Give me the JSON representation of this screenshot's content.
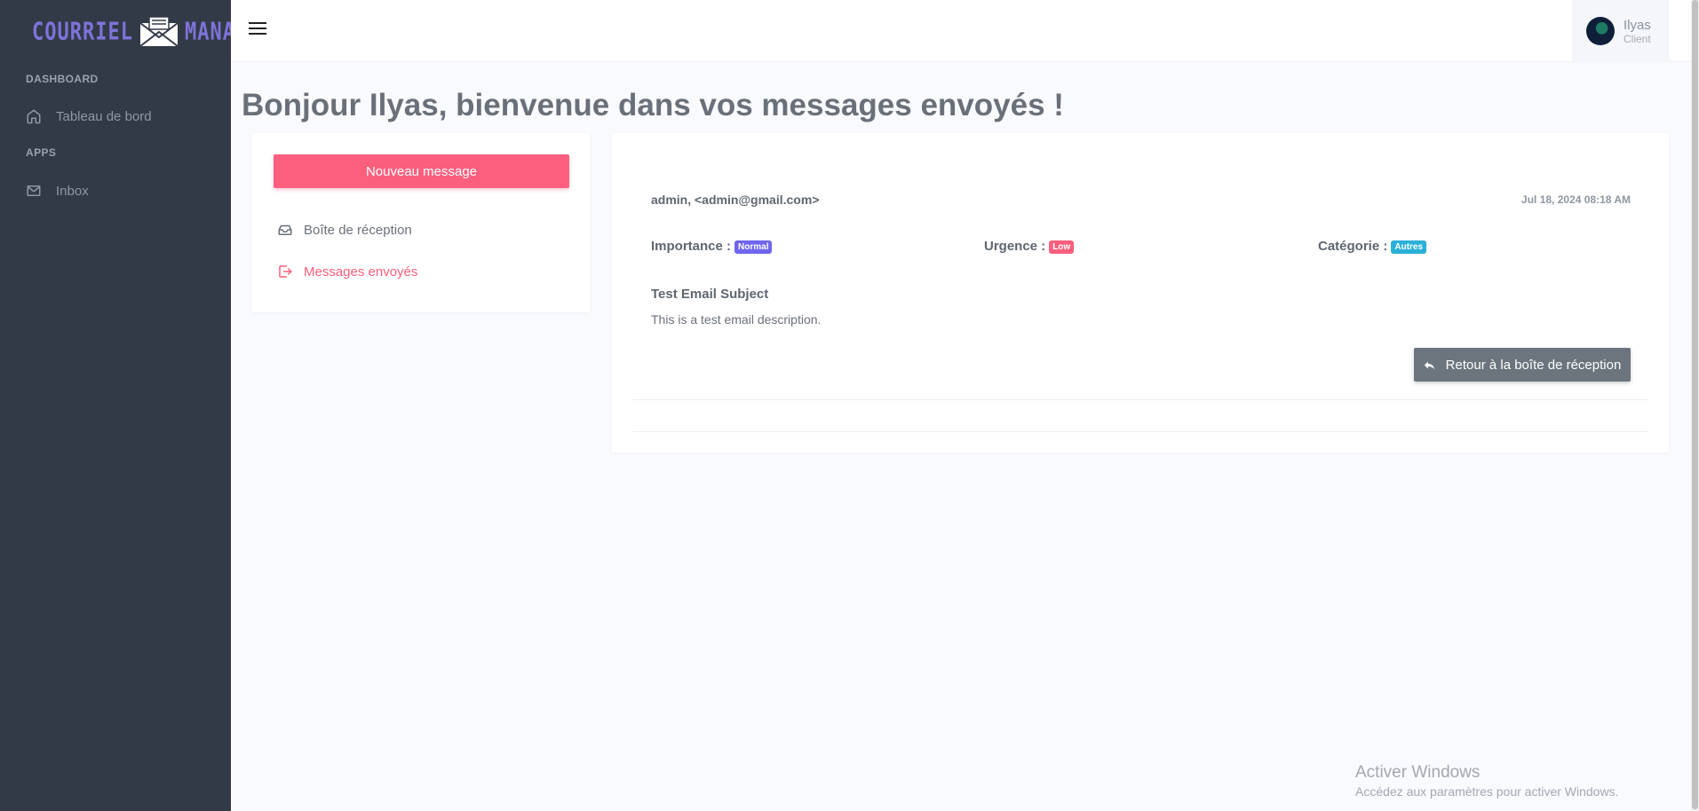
{
  "logo": {
    "left": "COURRIEL",
    "right": "MANAGER"
  },
  "sidebar": {
    "section_dashboard": "DASHBOARD",
    "item_dashboard": "Tableau de bord",
    "section_apps": "APPS",
    "item_inbox": "Inbox"
  },
  "user": {
    "name": "Ilyas",
    "role": "Client"
  },
  "page": {
    "title": "Bonjour Ilyas, bienvenue dans vos messages envoyés !"
  },
  "mailbox": {
    "new_message": "Nouveau message",
    "inbox": "Boîte de réception",
    "sent": "Messages envoyés"
  },
  "message": {
    "from": "admin, <admin@gmail.com>",
    "date": "Jul 18, 2024 08:18 AM",
    "importance_label": "Importance :",
    "importance_value": "Normal",
    "urgency_label": "Urgence :",
    "urgency_value": "Low",
    "category_label": "Catégorie :",
    "category_value": "Autres",
    "subject": "Test Email Subject",
    "description": "This is a test email description.",
    "back_button": "Retour à la boîte de réception"
  },
  "windows": {
    "title": "Activer Windows",
    "subtitle": "Accédez aux paramètres pour activer Windows."
  },
  "colors": {
    "sidebar_bg": "#333a47",
    "accent_pink": "#fb5f7d",
    "badge_normal": "#6f65ee",
    "badge_low": "#fb5f7d",
    "badge_autres": "#2ab0d8",
    "back_button": "#6c757d"
  }
}
